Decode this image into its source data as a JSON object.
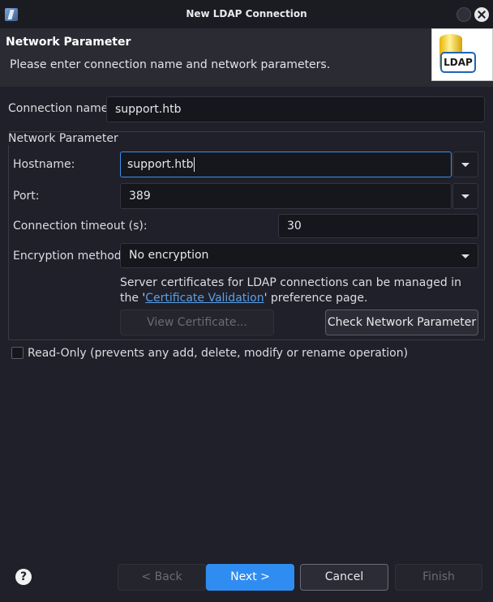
{
  "window": {
    "title": "New LDAP Connection"
  },
  "banner": {
    "title": "Network Parameter",
    "subtitle": "Please enter connection name and network parameters.",
    "logo_text": "LDAP"
  },
  "connection_name": {
    "label": "Connection name:",
    "value": "support.htb"
  },
  "network_group": {
    "legend": "Network Parameter",
    "hostname": {
      "label": "Hostname:",
      "value": "support.htb"
    },
    "port": {
      "label": "Port:",
      "value": "389"
    },
    "timeout": {
      "label": "Connection timeout (s):",
      "value": "30"
    },
    "encryption": {
      "label": "Encryption method:",
      "value": "No encryption"
    },
    "note": {
      "before": "Server certificates for LDAP connections can be managed in the '",
      "link": "Certificate Validation",
      "after": "' preference page."
    },
    "view_certificate_label": "View Certificate...",
    "check_label": "Check Network Parameter"
  },
  "read_only": {
    "label": "Read-Only (prevents any add, delete, modify or rename operation)",
    "checked": false
  },
  "footer": {
    "help_label": "?",
    "back_label": "< Back",
    "next_label": "Next >",
    "cancel_label": "Cancel",
    "finish_label": "Finish"
  },
  "colors": {
    "background": "#1f2029",
    "accent": "#2f8df1",
    "focus_border": "#3c8ef0",
    "link": "#5aa0ea"
  }
}
